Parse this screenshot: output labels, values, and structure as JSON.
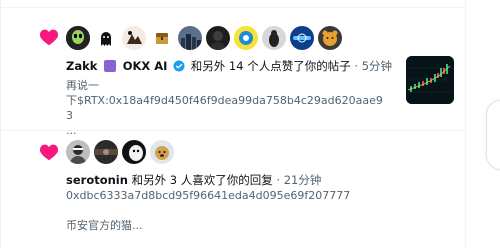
{
  "notifications": [
    {
      "avatar_icons": [
        "alien-avatar-icon",
        "ghost-avatar-icon",
        "art-avatar-icon",
        "chest-avatar-icon",
        "cityscape-avatar-icon",
        "dark-portrait-avatar-icon",
        "yellow-face-avatar-icon",
        "bird-avatar-icon",
        "blue-logo-avatar-icon",
        "bear-avatar-icon"
      ],
      "actor": "Zakk",
      "actor2": "OKX AI",
      "action": "和另外 14 个人点赞了你的帖子",
      "separator": "·",
      "time": "5分钟",
      "text_line1": "再说一",
      "text_line2": "下$RTX:0x18a4f9d450f46f9dea99da758b4c29ad620aae93",
      "text_more": "..."
    },
    {
      "avatar_icons": [
        "monochrome-avatar-icon",
        "dark-avatar-icon",
        "bw-dog-avatar-icon",
        "dog-avatar-icon"
      ],
      "actor": "serotonin",
      "action": "和另外 3 人喜欢了你的回复",
      "separator": "·",
      "time": "21分钟",
      "text_line1": "0xdbc6333a7d8bcd95f96641eda4d095e69f207777",
      "text_line2": "币安官方的猫..."
    }
  ],
  "colors": {
    "heart": "#f91880",
    "verified": "#1d9bf0",
    "badge": "#8a63d2",
    "muted": "#536471"
  }
}
